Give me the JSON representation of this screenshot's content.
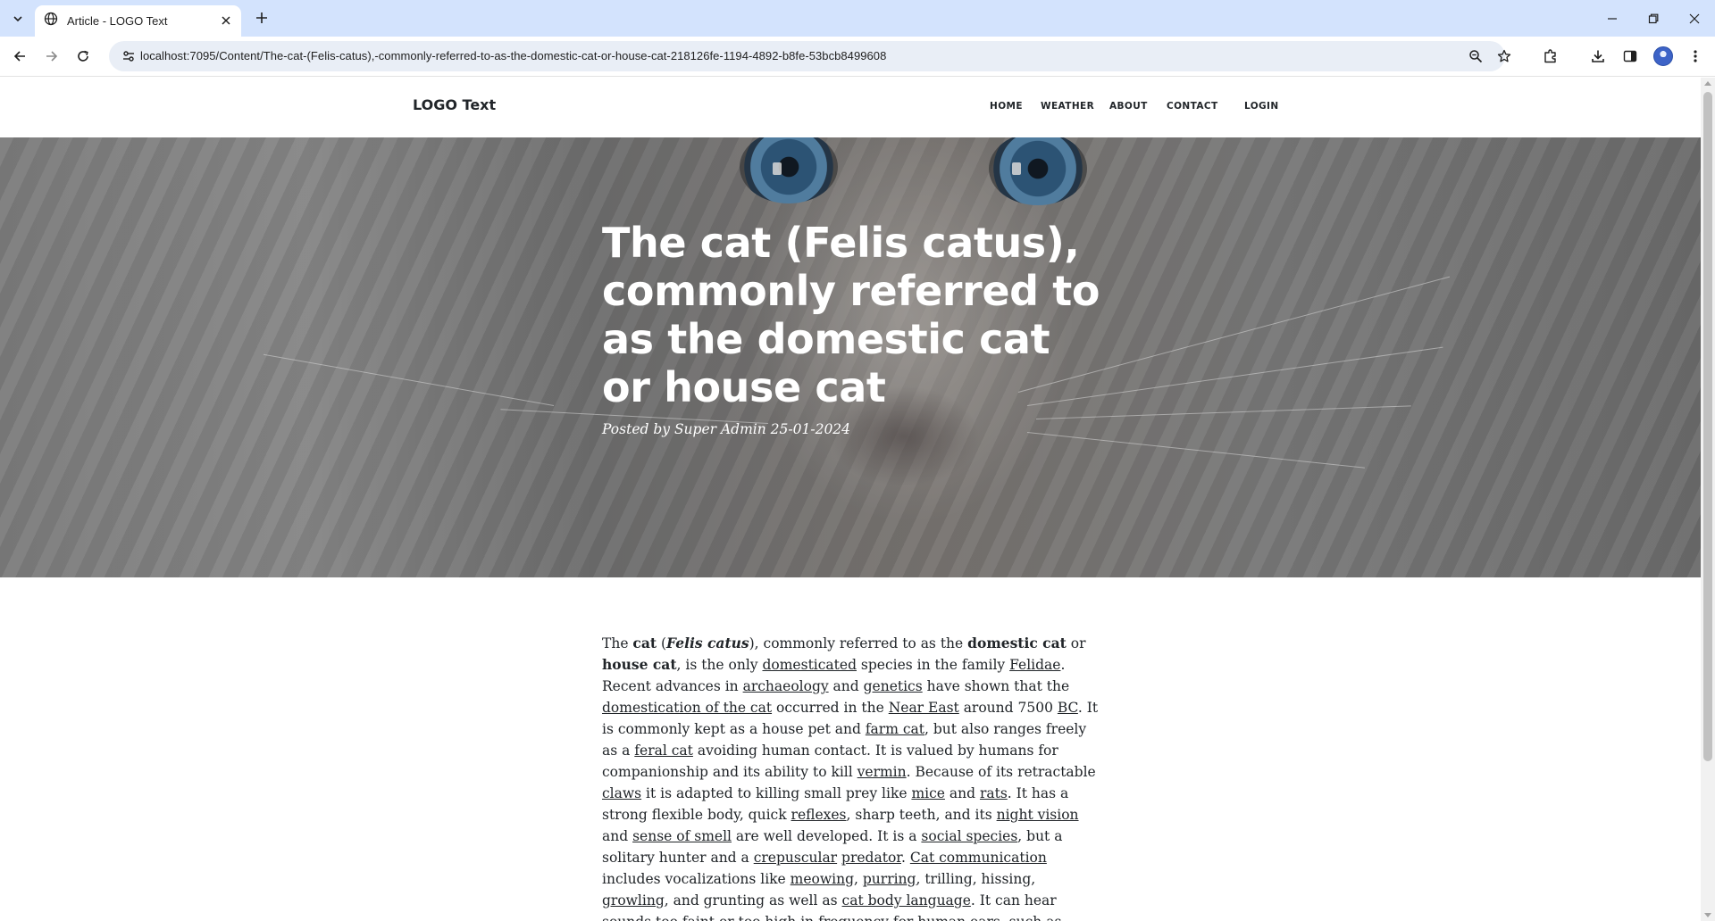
{
  "browser": {
    "tab_title": "Article - LOGO Text",
    "url": "localhost:7095/Content/The-cat-(Felis-catus),-commonly-referred-to-as-the-domestic-cat-or-house-cat-218126fe-1194-4892-b8fe-53bcb8499608",
    "icons": [
      "tab-search-icon",
      "globe-icon",
      "close-icon",
      "plus-icon",
      "minimize-icon",
      "restore-icon",
      "window-close-icon",
      "back-icon",
      "forward-icon",
      "reload-icon",
      "site-info-icon",
      "zoom-icon",
      "star-icon",
      "extensions-icon",
      "download-icon",
      "side-panel-icon",
      "profile-avatar",
      "kebab-menu-icon"
    ]
  },
  "site": {
    "logo": "LOGO Text",
    "nav": [
      "HOME",
      "WEATHER",
      "ABOUT",
      "CONTACT",
      "LOGIN"
    ]
  },
  "hero": {
    "title": "The cat (Felis catus), commonly referred to as the domestic cat or house cat",
    "meta": "Posted by Super Admin 25-01-2024"
  },
  "article": {
    "t1": "The ",
    "b1": "cat",
    "t2": " (",
    "b2": "Felis catus",
    "t3": "), commonly referred to as the ",
    "b3": "domestic cat",
    "t4": " or ",
    "b4": "house cat",
    "t5": ", is the only ",
    "l1": "domesticated",
    "t6": " species in the family ",
    "l2": "Felidae",
    "t7": ". Recent advances in ",
    "l3": "archaeology",
    "t8": " and ",
    "l4": "genetics",
    "t9": " have shown that the ",
    "l5": "domestication of the cat",
    "t10": " occurred in the ",
    "l6": "Near East",
    "t11": " around 7500 ",
    "l7": "BC",
    "t12": ". It is commonly kept as a house pet and ",
    "l8": "farm cat",
    "t13": ", but also ranges freely as a ",
    "l9": "feral cat",
    "t14": " avoiding human contact. It is valued by humans for companionship and its ability to kill ",
    "l10": "vermin",
    "t15": ". Because of its retractable ",
    "l11": "claws",
    "t16": " it is adapted to killing small prey like ",
    "l12": "mice",
    "t17": " and ",
    "l13": "rats",
    "t18": ". It has a strong flexible body, quick ",
    "l14": "reflexes",
    "t19": ", sharp teeth, and its ",
    "l15": "night vision",
    "t20": " and ",
    "l16": "sense of smell",
    "t21": " are well developed. It is a ",
    "l17": "social species",
    "t22": ", but a solitary hunter and a ",
    "l18": "crepuscular",
    "t23": " ",
    "l19": "predator",
    "t24": ". ",
    "l20": "Cat communication",
    "t25": " includes vocalizations like ",
    "l21": "meowing",
    "t26": ", ",
    "l22": "purring",
    "t27": ", trilling, hissing, ",
    "l23": "growling",
    "t28": ", and grunting as well as ",
    "l24": "cat body language",
    "t29": ". It can hear sounds too faint or too high in ",
    "l25": "frequency",
    "t30": " for human ears, such as those"
  }
}
